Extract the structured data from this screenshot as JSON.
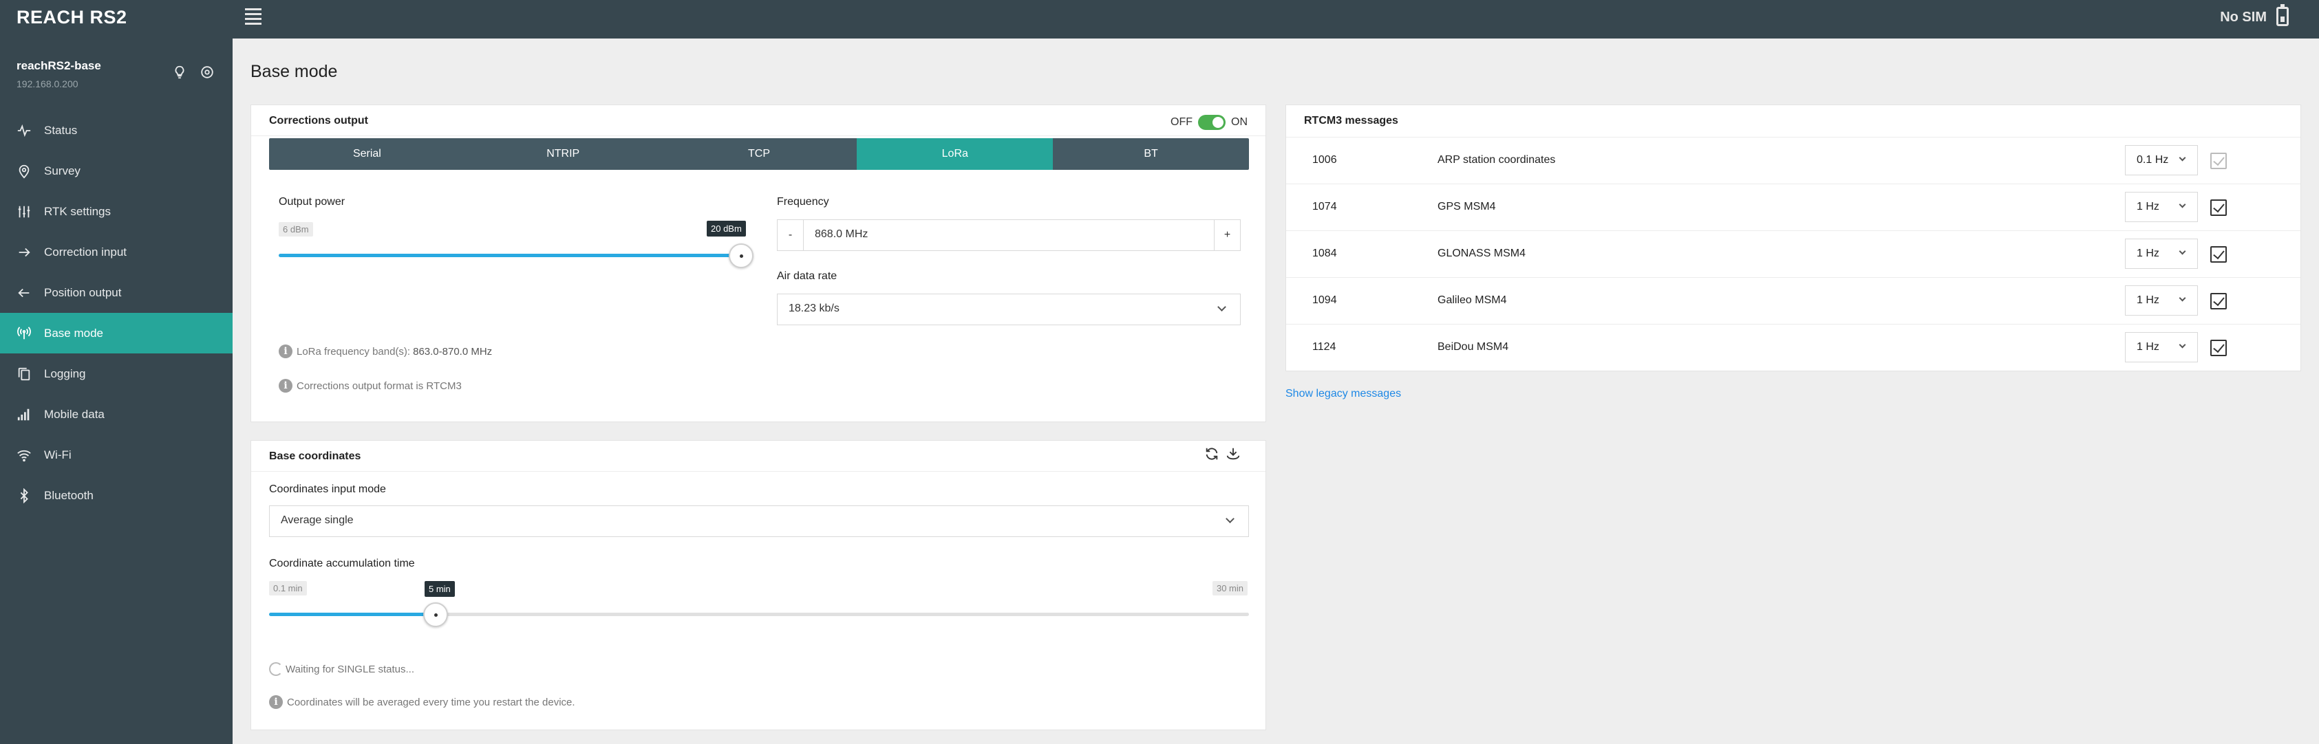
{
  "app": {
    "brand": "REACH RS2",
    "sim_status": "No SIM"
  },
  "device": {
    "name": "reachRS2-base",
    "ip": "192.168.0.200"
  },
  "sidebar": {
    "items": [
      {
        "label": "Status",
        "icon": "activity-icon",
        "active": false
      },
      {
        "label": "Survey",
        "icon": "map-pin-icon",
        "active": false
      },
      {
        "label": "RTK settings",
        "icon": "sliders-icon",
        "active": false
      },
      {
        "label": "Correction input",
        "icon": "arrow-right-icon",
        "active": false
      },
      {
        "label": "Position output",
        "icon": "arrow-left-icon",
        "active": false
      },
      {
        "label": "Base mode",
        "icon": "antenna-icon",
        "active": true
      },
      {
        "label": "Logging",
        "icon": "copy-icon",
        "active": false
      },
      {
        "label": "Mobile data",
        "icon": "signal-bars-icon",
        "active": false
      },
      {
        "label": "Wi-Fi",
        "icon": "wifi-icon",
        "active": false
      },
      {
        "label": "Bluetooth",
        "icon": "bluetooth-icon",
        "active": false
      }
    ]
  },
  "page": {
    "title": "Base mode"
  },
  "corrections": {
    "title": "Corrections output",
    "toggle_off": "OFF",
    "toggle_on": "ON",
    "enabled": true,
    "tabs": [
      "Serial",
      "NTRIP",
      "TCP",
      "LoRa",
      "BT"
    ],
    "active_tab": "LoRa",
    "output_power": {
      "label": "Output power",
      "min": "6 dBm",
      "value": "20 dBm",
      "fraction": 1.0
    },
    "frequency": {
      "label": "Frequency",
      "minus": "-",
      "value": "868.0 MHz",
      "plus": "+"
    },
    "air_rate": {
      "label": "Air data rate",
      "value": "18.23 kb/s"
    },
    "info_band_prefix": "LoRa frequency band(s): ",
    "info_band_value": "863.0-870.0 MHz",
    "info_format": "Corrections output format is RTCM3"
  },
  "base_coords": {
    "title": "Base coordinates",
    "mode_label": "Coordinates input mode",
    "mode_value": "Average single",
    "accum_label": "Coordinate accumulation time",
    "accum_min": "0.1 min",
    "accum_max": "30 min",
    "accum_value": "5 min",
    "accum_fraction": 0.17,
    "waiting": "Waiting for SINGLE status...",
    "info": "Coordinates will be averaged every time you restart the device."
  },
  "rtcm": {
    "title": "RTCM3 messages",
    "messages": [
      {
        "id": "1006",
        "name": "ARP station coordinates",
        "rate": "0.1 Hz",
        "checked": true,
        "disabled": true
      },
      {
        "id": "1074",
        "name": "GPS MSM4",
        "rate": "1 Hz",
        "checked": true,
        "disabled": false
      },
      {
        "id": "1084",
        "name": "GLONASS MSM4",
        "rate": "1 Hz",
        "checked": true,
        "disabled": false
      },
      {
        "id": "1094",
        "name": "Galileo MSM4",
        "rate": "1 Hz",
        "checked": true,
        "disabled": false
      },
      {
        "id": "1124",
        "name": "BeiDou MSM4",
        "rate": "1 Hz",
        "checked": true,
        "disabled": false
      }
    ],
    "legacy_link": "Show legacy messages"
  }
}
